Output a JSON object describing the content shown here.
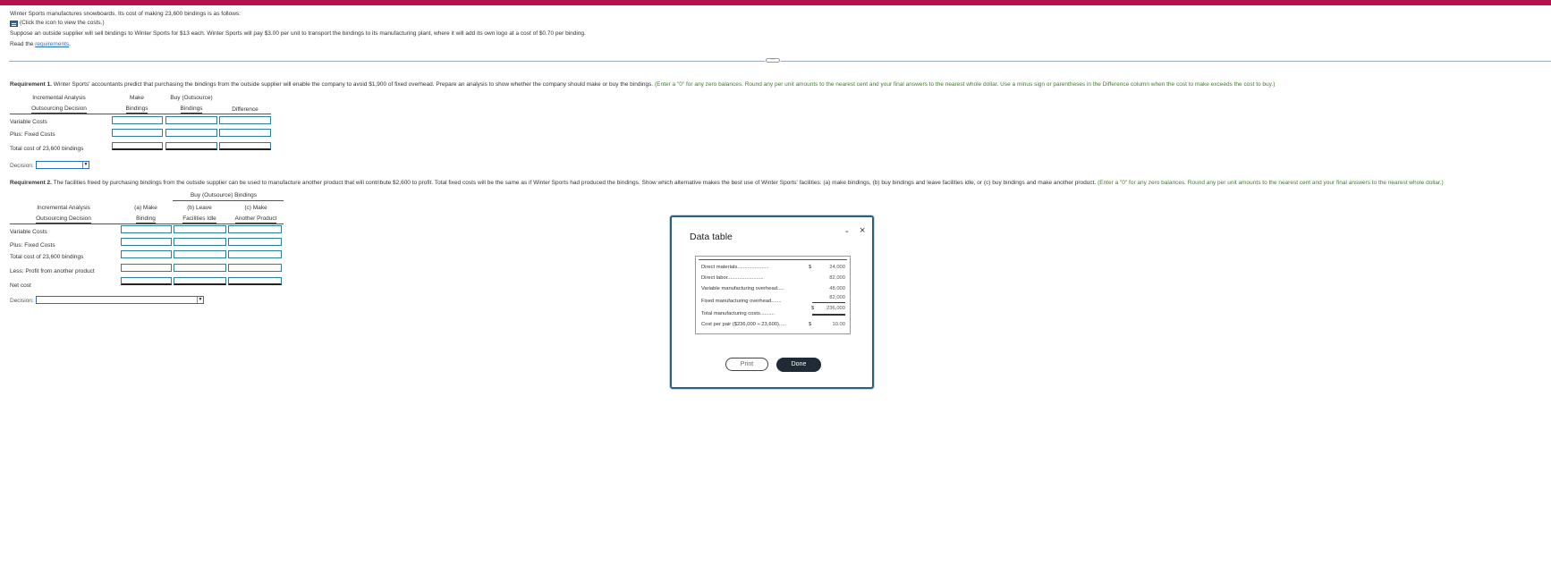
{
  "intro": {
    "line1": "Winter Sports manufactures snowboards. Its cost of making 23,600 bindings is as follows:",
    "click_icon_text": "(Click the icon to view the costs.)",
    "line2": "Suppose an outside supplier will sell bindings to Winter Sports for $13 each. Winter Sports will pay $3.00 per unit to transport the bindings to its manufacturing plant, where it will add its own logo at a cost of $0.70 per binding.",
    "read_prefix": "Read the ",
    "requirements_link": "requirements",
    "read_suffix": "."
  },
  "req1": {
    "label": "Requirement 1.",
    "text": " Winter Sports' accountants predict that purchasing the bindings from the outside supplier will enable the company to avoid $1,900 of fixed overhead. Prepare an analysis to show whether the company should make or buy the bindings.",
    "hint": " (Enter a \"0\" for any zero balances. Round any per unit amounts to the nearest cent and your final answers to the nearest whole dollar. Use a minus sign or parentheses in the Difference column when the cost to make exceeds the cost to buy.)",
    "headers": {
      "col0_line1": "Incremental Analysis",
      "col0_line2": "Outsourcing Decision",
      "col1_line1": "Make",
      "col1_line2": "Bindings",
      "col2_line1": "Buy (Outsource)",
      "col2_line2": "Bindings",
      "col3_line2": "Difference"
    },
    "rows": [
      "Variable Costs",
      "Plus: Fixed Costs",
      "Total cost of 23,600 bindings"
    ],
    "decision_label": "Decision:"
  },
  "req2": {
    "label": "Requirement 2.",
    "text": " The facilities freed by purchasing bindings from the outside supplier can be used to manufacture another product that will contribute $2,600 to profit. Total fixed costs will be the same as if Winter Sports had produced the bindings. Show which alternative makes the best use of Winter Sports' facilities: (a) make bindings, (b) buy bindings and leave facilities idle, or (c) buy bindings and make another product.",
    "hint": " (Enter a \"0\" for any zero balances. Round any per unit amounts to the nearest cent and your final answers to the nearest whole dollar.)",
    "headers": {
      "group": "Buy (Outsource) Bindings",
      "col0_line1": "Incremental Analysis",
      "col0_line2": "Outsourcing Decision",
      "col1_line1": "(a) Make",
      "col1_line2": "Binding",
      "col2_line1": "(b) Leave",
      "col2_line2": "Facilities Idle",
      "col3_line1": "(c) Make",
      "col3_line2": "Another Product"
    },
    "rows": [
      "Variable Costs",
      "Plus: Fixed Costs",
      "Total cost of 23,600 bindings",
      "Less: Profit from another product",
      "Net cost"
    ],
    "decision_label": "Decision:"
  },
  "dialog": {
    "title": "Data table",
    "minimize": "-",
    "close": "×",
    "rows": [
      {
        "label": "Direct materials",
        "dots": "......................",
        "symbol": "$",
        "value": "24,000"
      },
      {
        "label": "Direct labor",
        "dots": ".........................",
        "symbol": "",
        "value": "82,000"
      },
      {
        "label": "Variable manufacturing overhead",
        "dots": ".....",
        "symbol": "",
        "value": "48,000"
      },
      {
        "label": "Fixed manufacturing overhead",
        "dots": ".......",
        "symbol": "",
        "value": "82,000"
      },
      {
        "label": "Total manufacturing costs",
        "dots": "..........",
        "symbol": "$",
        "value": "236,000"
      },
      {
        "label": "Cost per pair ($236,000 ÷ 23,600)",
        "dots": ".....",
        "symbol": "$",
        "value": "10.00"
      }
    ],
    "print_label": "Print",
    "done_label": "Done"
  },
  "colors": {
    "brand_bar": "#b5104f",
    "hint_green": "#3f7d2b",
    "link_blue": "#2a6ebb",
    "input_border": "#2c7ea1",
    "done_button": "#1f2a36"
  }
}
